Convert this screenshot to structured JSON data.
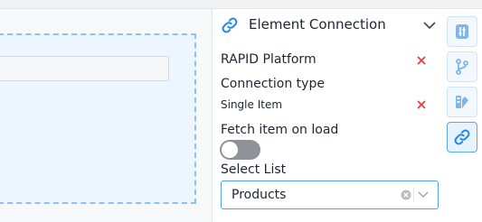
{
  "panel": {
    "title": "Element Connection",
    "platform_label": "RAPID Platform",
    "connection_type_label": "Connection type",
    "connection_type_value": "Single Item",
    "fetch_label": "Fetch item on load",
    "fetch_on_load": false,
    "select_list_label": "Select List",
    "select_list_value": "Products"
  },
  "icons": {
    "header": "link-icon",
    "collapse": "chevron-down-icon",
    "remove": "close-icon",
    "clear": "clear-circle-icon",
    "dropdown": "chevron-down-icon"
  },
  "toolbar": {
    "items": [
      {
        "icon": "sliders-icon",
        "active": false
      },
      {
        "icon": "branch-icon",
        "active": false
      },
      {
        "icon": "style-icon",
        "active": false
      },
      {
        "icon": "link-icon",
        "active": true
      }
    ]
  },
  "colors": {
    "accent": "#1e88e5",
    "remove_red": "#e53935",
    "toggle_off": "#8e9298",
    "selection_border": "#8ec1f0"
  }
}
